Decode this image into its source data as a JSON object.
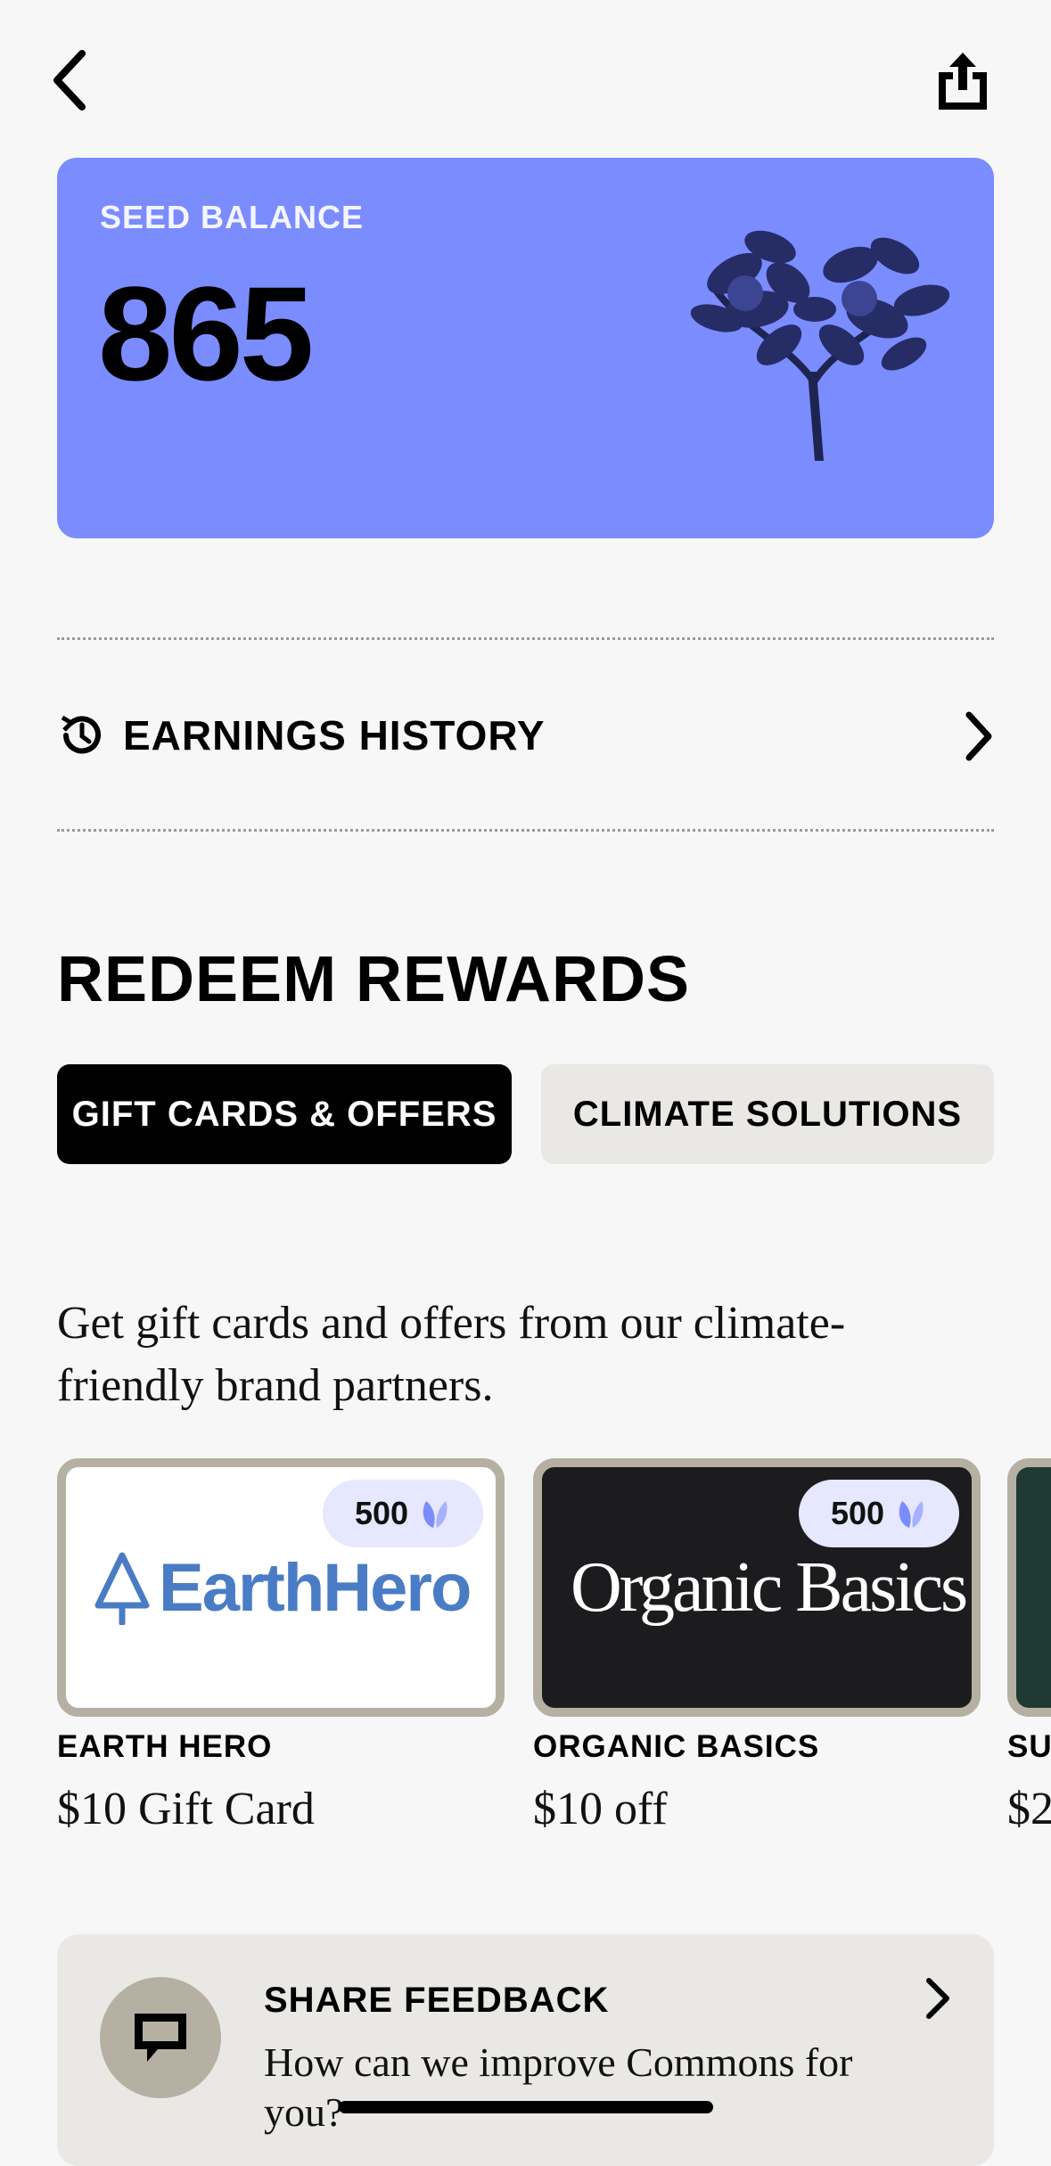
{
  "nav": {
    "back_icon": "chevron-left-icon",
    "share_icon": "share-icon"
  },
  "balance": {
    "label": "SEED BALANCE",
    "value": "865",
    "card_color": "#7b8cff",
    "illustration": "citrus-tree-illustration"
  },
  "earnings": {
    "label": "EARNINGS HISTORY",
    "icon": "history-icon"
  },
  "redeem": {
    "title": "REDEEM REWARDS",
    "tabs": [
      {
        "label": "GIFT CARDS & OFFERS",
        "active": true
      },
      {
        "label": "CLIMATE SOLUTIONS",
        "active": false
      }
    ],
    "description": "Get gift cards and offers from our climate-friendly brand partners.",
    "offers": [
      {
        "logo_text": "EarthHero",
        "cost": "500",
        "brand": "EARTH HERO",
        "title": "$10 Gift Card"
      },
      {
        "logo_text": "Organic Basics",
        "cost": "500",
        "brand": "ORGANIC BASICS",
        "title": "$10 off"
      },
      {
        "brand": "SU",
        "title": "$2"
      }
    ]
  },
  "feedback": {
    "title": "SHARE FEEDBACK",
    "text": "How can we improve Commons for you?",
    "icon": "chat-bubble-icon"
  },
  "colors": {
    "accent": "#7b8cff",
    "badge_bg": "#e5e8ff",
    "card_border": "#b6b0a3",
    "earthhero_blue": "#4a7cc6"
  }
}
